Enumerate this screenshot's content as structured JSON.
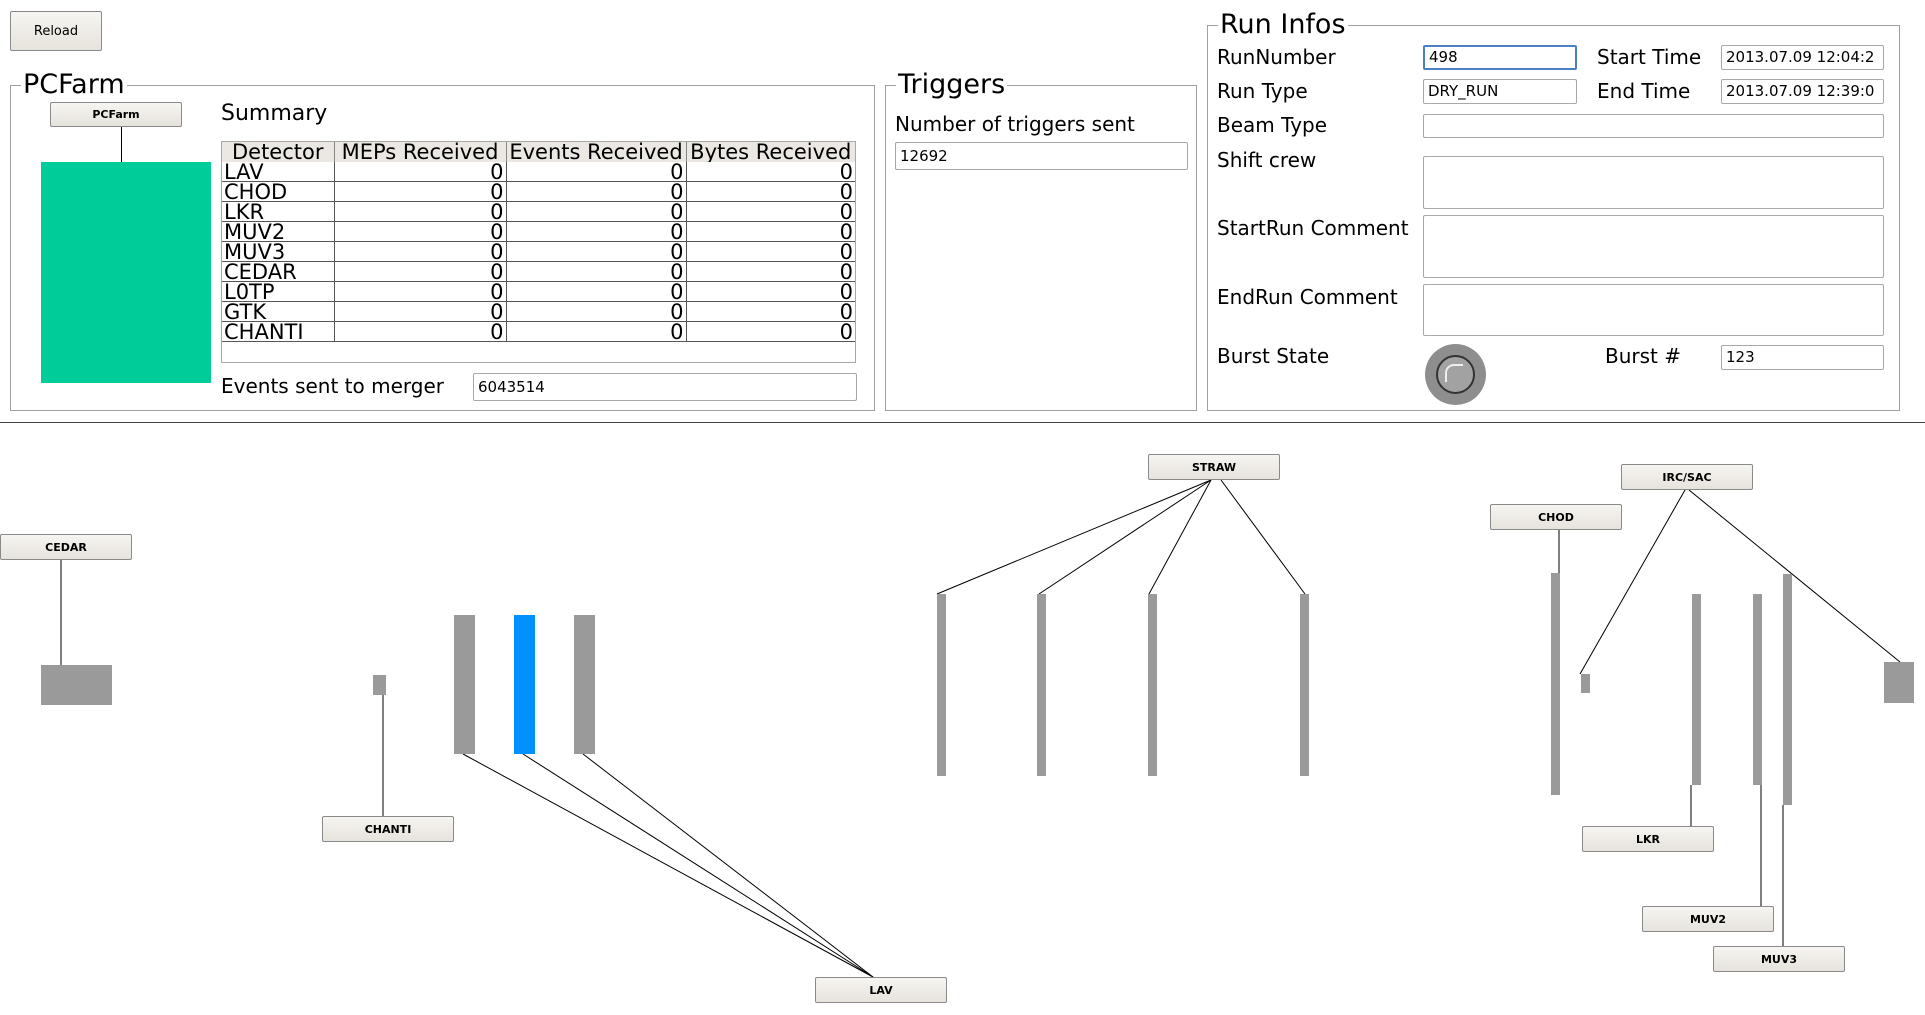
{
  "toolbar": {
    "reload_label": "Reload"
  },
  "pcfarm": {
    "title": "PCFarm",
    "node_label": "PCFarm",
    "summary_title": "Summary",
    "columns": [
      "Detector",
      "MEPs Received",
      "Events Received",
      "Bytes Received"
    ],
    "rows": [
      [
        "LAV",
        "0",
        "0",
        "0"
      ],
      [
        "CHOD",
        "0",
        "0",
        "0"
      ],
      [
        "LKR",
        "0",
        "0",
        "0"
      ],
      [
        "MUV2",
        "0",
        "0",
        "0"
      ],
      [
        "MUV3",
        "0",
        "0",
        "0"
      ],
      [
        "CEDAR",
        "0",
        "0",
        "0"
      ],
      [
        "L0TP",
        "0",
        "0",
        "0"
      ],
      [
        "GTK",
        "0",
        "0",
        "0"
      ],
      [
        "CHANTI",
        "0",
        "0",
        "0"
      ]
    ],
    "events_merger_label": "Events sent to merger",
    "events_merger_value": "6043514",
    "status_color": "#00cc99"
  },
  "triggers": {
    "title": "Triggers",
    "count_label": "Number of triggers sent",
    "count_value": "12692"
  },
  "run_infos": {
    "title": "Run Infos",
    "run_number_label": "RunNumber",
    "run_number_value": "498",
    "run_type_label": "Run Type",
    "run_type_value": "DRY_RUN",
    "start_time_label": "Start Time",
    "start_time_value": "2013.07.09 12:04:2",
    "end_time_label": "End Time",
    "end_time_value": "2013.07.09 12:39:0",
    "beam_type_label": "Beam Type",
    "beam_type_value": "",
    "shift_crew_label": "Shift crew",
    "shift_crew_value": "",
    "start_comment_label": "StartRun Comment",
    "start_comment_value": "",
    "end_comment_label": "EndRun Comment",
    "end_comment_value": "",
    "burst_state_label": "Burst State",
    "burst_number_label": "Burst #",
    "burst_number_value": "123"
  },
  "detector_map": {
    "nodes": {
      "cedar": "CEDAR",
      "chanti": "CHANTI",
      "lav": "LAV",
      "straw": "STRAW",
      "chod": "CHOD",
      "irc_sac": "IRC/SAC",
      "lkr": "LKR",
      "muv2": "MUV2",
      "muv3": "MUV3"
    },
    "colors": {
      "idle": "#9a9a9a",
      "active": "#0091ff"
    }
  }
}
